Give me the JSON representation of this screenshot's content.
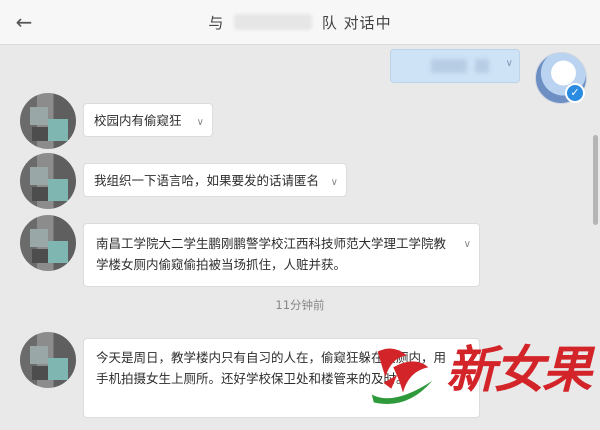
{
  "header": {
    "title_prefix": "与",
    "title_suffix": "队 对话中",
    "back_icon": "arrow-left-icon"
  },
  "messages": [
    {
      "text": "校园内有偷窥狂"
    },
    {
      "text": "我组织一下语言哈，如果要发的话请匿名"
    },
    {
      "text": "南昌工学院大二学生鹏刚鹏警学校江西科技师范大学理工学院教学楼女厕内偷窥偷拍被当场抓住，人赃并获。"
    },
    {
      "text": "今天是周日，教学楼内只有自习的人在，偷窥狂躲在女厕内，用手机拍摄女生上厕所。还好学校保卫处和楼管来的及时。"
    }
  ],
  "time_divider": "11分钟前",
  "watermark": {
    "text": "新女果"
  },
  "colors": {
    "bubble_bg": "#ffffff",
    "my_bubble_bg": "#cfe3f7",
    "watermark_red": "#d3242a",
    "watermark_green": "#2f9a3b",
    "verified_blue": "#2a8be0"
  }
}
